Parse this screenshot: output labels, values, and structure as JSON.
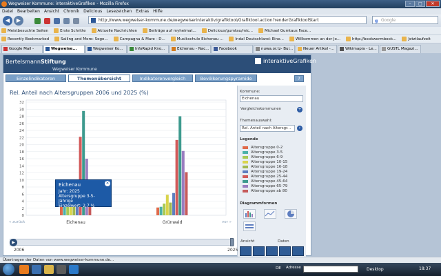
{
  "window": {
    "title": "Wegweiser Kommune: interaktiveGrafiken - Mozilla Firefox"
  },
  "menu": [
    "Datei",
    "Bearbeiten",
    "Ansicht",
    "Chronik",
    "Delicious",
    "Lesezeichen",
    "Extras",
    "Hilfe"
  ],
  "nav": {
    "url": "http://www.wegweiser-kommune.de/wegweiserinteraktiv/grafiktool/Grafiktool.action?renderGrafiktoolStart",
    "search_placeholder": "Google"
  },
  "bookmarks_row1": [
    "Meistbesuchte Seiten",
    "Erste Schritte",
    "Aktuelle Nachrichten",
    "Beiträge auf myheimat...",
    "Delicious/gumtau/mic...",
    "Michael Gumtaus Face..."
  ],
  "bookmarks_row2": [
    "Recently Bookmarked",
    "Sailing and More: Sege...",
    "Campagna & Mare - D...",
    "Musikschule Eichenau ...",
    "Indal Deutschland: Eine...",
    "Willkommen an der Jo...",
    "http://bookwormbook...",
    "Jetztlaufzeit"
  ],
  "tabs": [
    "Google Mail -",
    "Wegweise...",
    "Wegweiser Ko...",
    "InfoRapid Kno...",
    "Eichenau - Nac...",
    "Facebook",
    "nuwa.or.tz- Bui...",
    "Neuer Artikel -...",
    "Wikimapia - Le...",
    "GUSTL Magazi..."
  ],
  "header": {
    "logo_left_a": "Bertelsmann",
    "logo_left_b": "Stiftung",
    "subtitle": "Wegweiser Kommune",
    "logo_right": "interaktiveGrafiken"
  },
  "app_tabs": {
    "t1": "Einzelindikatoren",
    "t2": "Themenübersicht",
    "t3": "Indikatorenvergleich",
    "t4": "Bevölkerungspyramide",
    "help": "?"
  },
  "chart_title": "Rel. Anteil nach Altersgruppen 2006 und 2025 (%)",
  "nav_links": {
    "back": "« zurück",
    "forward": "vor »"
  },
  "panel": {
    "kommune_label": "Kommune:",
    "kommune_value": "Eichenau",
    "vergleich": "Vergleichskommunen",
    "thema_label": "Themenauswahl:",
    "thema_value": "Rel. Anteil nach Altersgr...",
    "legende": "Legende",
    "diagrammformen": "Diagrammformen",
    "ansicht": "Ansicht",
    "daten": "Daten"
  },
  "tooltip": {
    "title": "Eichenau",
    "line1": "Jahr: 2025",
    "line2": "Altersgruppe 3-5-Jährige",
    "line3": "Einzelwert: 2,7 %",
    "close": "✕"
  },
  "timeline": {
    "start": "2006",
    "end": "2025"
  },
  "status": "Übertragen der Daten von www.wegweiser-kommune.de...",
  "taskbar": {
    "de": "DE",
    "adresse": "Adresse",
    "desktop": "Desktop",
    "clock": "18:37"
  },
  "colors": {
    "brand": "#2c4e78",
    "tab": "#7aa0c8"
  },
  "chart_data": {
    "type": "bar",
    "categories": [
      "Eichenau",
      "Grünwald"
    ],
    "ylim": [
      0,
      32
    ],
    "yticks": [
      0,
      2,
      4,
      6,
      8,
      10,
      12,
      14,
      16,
      18,
      20,
      22,
      24,
      26,
      28,
      30,
      32
    ],
    "series": [
      {
        "name": "Altersgruppe 0-2",
        "color": "#e06a4a",
        "values": [
          2.6,
          2.2
        ]
      },
      {
        "name": "Altersgruppe 3-5",
        "color": "#4bb0a8",
        "values": [
          2.7,
          2.4
        ]
      },
      {
        "name": "Altersgruppe 6-9",
        "color": "#a8c852",
        "values": [
          3.4,
          3.3
        ]
      },
      {
        "name": "Altersgruppe 10-15",
        "color": "#d9d44b",
        "values": [
          5.2,
          5.8
        ]
      },
      {
        "name": "Altersgruppe 16-18",
        "color": "#a0b850",
        "values": [
          3.0,
          3.6
        ]
      },
      {
        "name": "Altersgruppe 19-24",
        "color": "#5e7ec0",
        "values": [
          6.0,
          6.3
        ]
      },
      {
        "name": "Altersgruppe 25-44",
        "color": "#d25a5a",
        "values": [
          22.2,
          21.3
        ]
      },
      {
        "name": "Altersgruppe 45-64",
        "color": "#3d9a8e",
        "values": [
          29.5,
          28.0
        ]
      },
      {
        "name": "Altersgruppe 65-79",
        "color": "#9a7dc0",
        "values": [
          16.0,
          18.2
        ]
      },
      {
        "name": "Altersgruppe ab 80",
        "color": "#c65a5a",
        "values": [
          6.2,
          12.2
        ]
      }
    ]
  }
}
